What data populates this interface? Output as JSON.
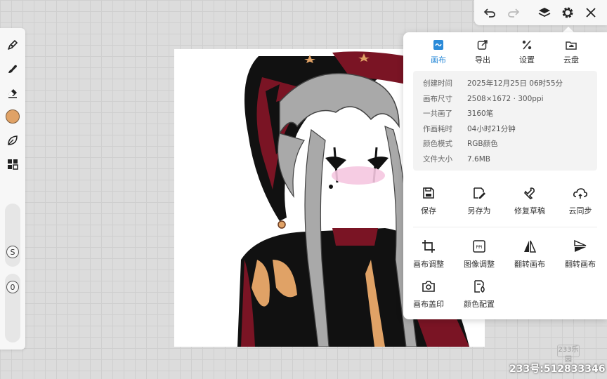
{
  "brand_color": "#2a8ad8",
  "current_color": "#e0a266",
  "left_toolbar": {
    "tools": [
      "brush-icon",
      "smudge-icon",
      "eraser-icon",
      "color-swatch",
      "leaf-icon",
      "grid-icon"
    ],
    "size_slider_label": "S",
    "opacity_slider_label": "0"
  },
  "top_toolbar": {
    "icons": [
      "undo-icon",
      "redo-icon",
      "layers-icon",
      "gear-icon",
      "close-icon"
    ]
  },
  "panel": {
    "tabs": [
      {
        "label": "画布",
        "icon": "canvas-icon",
        "active": true
      },
      {
        "label": "导出",
        "icon": "export-icon",
        "active": false
      },
      {
        "label": "设置",
        "icon": "settings-icon",
        "active": false
      },
      {
        "label": "云盘",
        "icon": "cloud-drive-icon",
        "active": false
      }
    ],
    "info": [
      {
        "key": "创建时间",
        "value": "2025年12月25日 06时55分"
      },
      {
        "key": "画布尺寸",
        "value": "2508×1672 · 300ppi"
      },
      {
        "key": "一共画了",
        "value": "3160笔"
      },
      {
        "key": "作画耗时",
        "value": "04小时21分钟"
      },
      {
        "key": "颜色模式",
        "value": "RGB颜色"
      },
      {
        "key": "文件大小",
        "value": "7.6MB"
      }
    ],
    "actions_row1": [
      {
        "label": "保存",
        "icon": "save-icon"
      },
      {
        "label": "另存为",
        "icon": "save-as-icon"
      },
      {
        "label": "修复草稿",
        "icon": "repair-icon"
      },
      {
        "label": "云同步",
        "icon": "cloud-sync-icon"
      }
    ],
    "actions_row2": [
      {
        "label": "画布调整",
        "icon": "crop-icon"
      },
      {
        "label": "图像调整",
        "icon": "ppi-icon"
      },
      {
        "label": "翻转画布",
        "icon": "flip-horizontal-icon"
      },
      {
        "label": "翻转画布",
        "icon": "flip-vertical-icon"
      }
    ],
    "actions_row3": [
      {
        "label": "画布盖印",
        "icon": "camera-icon"
      },
      {
        "label": "颜色配置",
        "icon": "color-config-icon"
      }
    ],
    "ppi_badge": "PPI"
  },
  "watermark": {
    "logo_text": "233乐园",
    "id_text": "233号:512833346"
  }
}
